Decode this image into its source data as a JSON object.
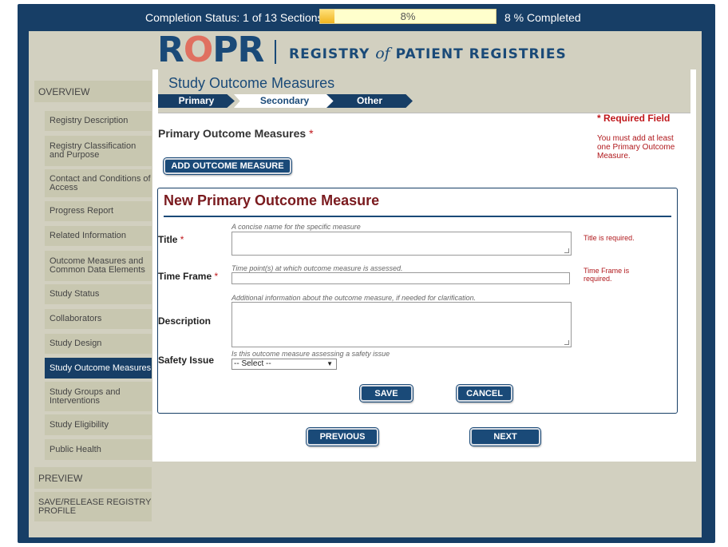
{
  "status": {
    "completion_text": "Completion Status: 1 of 13 Sections",
    "progress_percent": 8,
    "progress_label": "8%",
    "completed_text": "8 % Completed"
  },
  "logo": {
    "word_r1": "R",
    "word_o": "O",
    "word_pr": "PR",
    "sub_left": "REGISTRY",
    "sub_of": "of",
    "sub_right": "PATIENT REGISTRIES"
  },
  "sidebar": {
    "overview": "OVERVIEW",
    "items": [
      "Registry Description",
      "Registry Classification and Purpose",
      "Contact and Conditions of Access",
      "Progress Report",
      "Related Information",
      "Outcome Measures and Common Data Elements",
      "Study Status",
      "Collaborators",
      "Study Design",
      "Study Outcome Measures",
      "Study Groups and Interventions",
      "Study Eligibility",
      "Public Health"
    ],
    "preview": "PREVIEW",
    "save_release": "SAVE/RELEASE REGISTRY PROFILE"
  },
  "page": {
    "title": "Study Outcome Measures",
    "steps": [
      "Primary",
      "Secondary",
      "Other"
    ],
    "required_field": "* Required Field",
    "required_note": "You must add at least one Primary Outcome Measure.",
    "section_heading": "Primary Outcome Measures",
    "required_star": "*",
    "add_button": "ADD OUTCOME MEASURE"
  },
  "form": {
    "heading": "New Primary Outcome Measure",
    "title_label": "Title",
    "title_hint": "A concise name for the specific measure",
    "title_error": "Title is required.",
    "timeframe_label": "Time Frame",
    "timeframe_hint": "Time point(s) at which outcome measure is assessed.",
    "timeframe_error": "Time Frame is required.",
    "description_label": "Description",
    "description_hint": "Additional information about the outcome measure, if needed for clarification.",
    "safety_label": "Safety Issue",
    "safety_hint": "Is this outcome measure assessing a safety issue",
    "safety_selected": "-- Select --",
    "save_button": "SAVE",
    "cancel_button": "CANCEL"
  },
  "nav": {
    "previous": "PREVIOUS",
    "next": "NEXT"
  },
  "colors": {
    "navy": "#173e66",
    "required_red": "#c0181c",
    "heading_maroon": "#7a1a1e",
    "panel_beige": "#d2d0c0"
  }
}
